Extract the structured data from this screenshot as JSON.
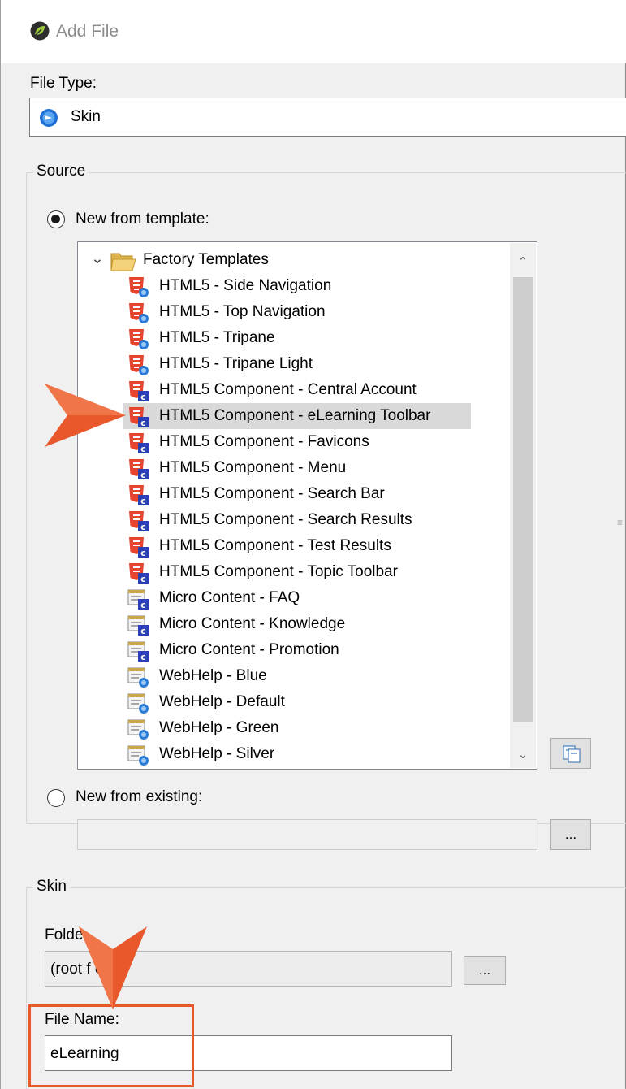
{
  "window": {
    "title": "Add File"
  },
  "file_type": {
    "label": "File Type:",
    "value": "Skin"
  },
  "source": {
    "legend": "Source",
    "new_from_template_label": "New from template:",
    "new_from_existing_label": "New from existing:",
    "existing_path": "",
    "browse_label": "..."
  },
  "tree": {
    "root_label": "Factory Templates",
    "items": [
      {
        "label": "HTML5 - Side Navigation",
        "kind": "html5"
      },
      {
        "label": "HTML5 - Top Navigation",
        "kind": "html5"
      },
      {
        "label": "HTML5 - Tripane",
        "kind": "html5"
      },
      {
        "label": "HTML5 - Tripane Light",
        "kind": "html5"
      },
      {
        "label": "HTML5 Component - Central Account",
        "kind": "component"
      },
      {
        "label": "HTML5 Component - eLearning Toolbar",
        "kind": "component",
        "selected": true
      },
      {
        "label": "HTML5 Component - Favicons",
        "kind": "component"
      },
      {
        "label": "HTML5 Component - Menu",
        "kind": "component"
      },
      {
        "label": "HTML5 Component - Search Bar",
        "kind": "component"
      },
      {
        "label": "HTML5 Component - Search Results",
        "kind": "component"
      },
      {
        "label": "HTML5 Component - Test Results",
        "kind": "component"
      },
      {
        "label": "HTML5 Component - Topic Toolbar",
        "kind": "component"
      },
      {
        "label": "Micro Content - FAQ",
        "kind": "micro"
      },
      {
        "label": "Micro Content - Knowledge",
        "kind": "micro"
      },
      {
        "label": "Micro Content - Promotion",
        "kind": "micro"
      },
      {
        "label": "WebHelp - Blue",
        "kind": "webhelp"
      },
      {
        "label": "WebHelp - Default",
        "kind": "webhelp"
      },
      {
        "label": "WebHelp - Green",
        "kind": "webhelp"
      },
      {
        "label": "WebHelp - Silver",
        "kind": "webhelp"
      }
    ]
  },
  "skin": {
    "legend": "Skin",
    "folder_label": "Folde",
    "folder_value": "(root f   er)",
    "folder_browse": "...",
    "filename_label": "File Name:",
    "filename_value": "eLearning"
  },
  "colors": {
    "callout": "#e8582a",
    "selection": "#d9d9d9",
    "html5_red": "#e8432f",
    "component_blue": "#2b3fb5"
  }
}
